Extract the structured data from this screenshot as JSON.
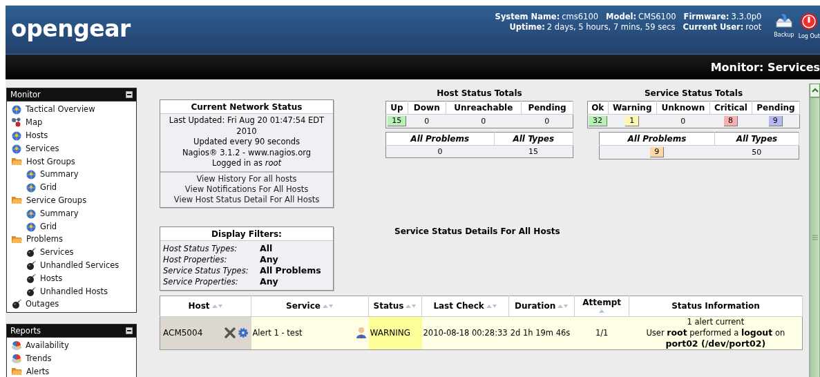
{
  "header": {
    "logo": "opengear",
    "info_lines": [
      [
        {
          "label": "System Name:",
          "value": "cms6100"
        },
        {
          "label": "Model:",
          "value": "CMS6100"
        },
        {
          "label": "Firmware:",
          "value": "3.3.0p0"
        }
      ],
      [
        {
          "label": "Uptime:",
          "value": "2 days, 5 hours, 7 mins, 59 secs"
        },
        {
          "label": "Current User:",
          "value": "root"
        }
      ]
    ],
    "buttons": [
      {
        "label": "Backup",
        "kind": "backup"
      },
      {
        "label": "Log Out",
        "kind": "logout"
      }
    ]
  },
  "page_title": "Monitor: Services",
  "sidebar": {
    "panels": [
      {
        "title": "Monitor",
        "items": [
          {
            "label": "Tactical Overview",
            "kind": "globe"
          },
          {
            "label": "Map",
            "kind": "map"
          },
          {
            "label": "Hosts",
            "kind": "globe"
          },
          {
            "label": "Services",
            "kind": "globe"
          },
          {
            "label": "Host Groups",
            "kind": "folder",
            "children": [
              {
                "label": "Summary",
                "kind": "globe"
              },
              {
                "label": "Grid",
                "kind": "globe"
              }
            ]
          },
          {
            "label": "Service Groups",
            "kind": "folder",
            "children": [
              {
                "label": "Summary",
                "kind": "globe"
              },
              {
                "label": "Grid",
                "kind": "globe"
              }
            ]
          },
          {
            "label": "Problems",
            "kind": "folder",
            "children": [
              {
                "label": "Services",
                "kind": "bomb"
              },
              {
                "label": "Unhandled Services",
                "kind": "bomb"
              },
              {
                "label": "Hosts",
                "kind": "bomb"
              },
              {
                "label": "Unhandled Hosts",
                "kind": "bomb"
              }
            ]
          },
          {
            "label": "Outages",
            "kind": "bomb"
          }
        ]
      },
      {
        "title": "Reports",
        "items": [
          {
            "label": "Availability",
            "kind": "pie"
          },
          {
            "label": "Trends",
            "kind": "pie"
          },
          {
            "label": "Alerts",
            "kind": "folder"
          }
        ]
      }
    ]
  },
  "network_status": {
    "title": "Current Network Status",
    "lines": [
      "Last Updated: Fri Aug 20 01:47:54 EDT 2010",
      "Updated every 90 seconds",
      "Nagios® 3.1.2 - www.nagios.org",
      "Logged in as *root*"
    ],
    "links": [
      "View History For all hosts",
      "View Notifications For All Hosts",
      "View Host Status Detail For All Hosts"
    ]
  },
  "host_totals": {
    "title": "Host Status Totals",
    "counts": [
      {
        "label": "Up",
        "value": "15",
        "color": "#b8f0b8"
      },
      {
        "label": "Down",
        "value": "0"
      },
      {
        "label": "Unreachable",
        "value": "0"
      },
      {
        "label": "Pending",
        "value": "0"
      }
    ],
    "summary": [
      {
        "label": "All Problems",
        "value": "0"
      },
      {
        "label": "All Types",
        "value": "15"
      }
    ]
  },
  "service_totals": {
    "title": "Service Status Totals",
    "counts": [
      {
        "label": "Ok",
        "value": "32",
        "color": "#b8f0b8"
      },
      {
        "label": "Warning",
        "value": "1",
        "color": "#fcf8b0"
      },
      {
        "label": "Unknown",
        "value": "0"
      },
      {
        "label": "Critical",
        "value": "8",
        "color": "#f8b0b0"
      },
      {
        "label": "Pending",
        "value": "9",
        "color": "#b8b8f0"
      }
    ],
    "summary": [
      {
        "label": "All Problems",
        "value": "9",
        "color": "#fcd8a8"
      },
      {
        "label": "All Types",
        "value": "50"
      }
    ]
  },
  "display_filters": {
    "title": "Display Filters:",
    "rows": [
      {
        "label": "Host Status Types:",
        "value": "All"
      },
      {
        "label": "Host Properties:",
        "value": "Any"
      },
      {
        "label": "Service Status Types:",
        "value": "All Problems"
      },
      {
        "label": "Service Properties:",
        "value": "Any"
      }
    ]
  },
  "details_title": "Service Status Details For All Hosts",
  "table": {
    "columns": [
      {
        "label": "Host",
        "sortable": true,
        "sorted": false
      },
      {
        "label": "Service",
        "sortable": true,
        "sorted": false
      },
      {
        "label": "Status",
        "sortable": true,
        "sorted": false
      },
      {
        "label": "Last Check",
        "sortable": true,
        "sorted": false
      },
      {
        "label": "Duration",
        "sortable": true,
        "sorted": false
      },
      {
        "label": "Attempt",
        "sortable": true,
        "sorted": true
      },
      {
        "label": "Status Information",
        "sortable": false,
        "sorted": false
      }
    ],
    "rows": [
      {
        "host": "ACM5004",
        "service": "Alert 1 - test",
        "status": "WARNING",
        "color": "#fefe98",
        "last_check": "2010-08-18 00:28:33",
        "duration": "2d 1h 19m 46s",
        "attempt": "1/1",
        "info": [
          "1 alert current",
          "User **root** performed a **logout** on **port02 (/dev/port02)**"
        ]
      }
    ]
  }
}
